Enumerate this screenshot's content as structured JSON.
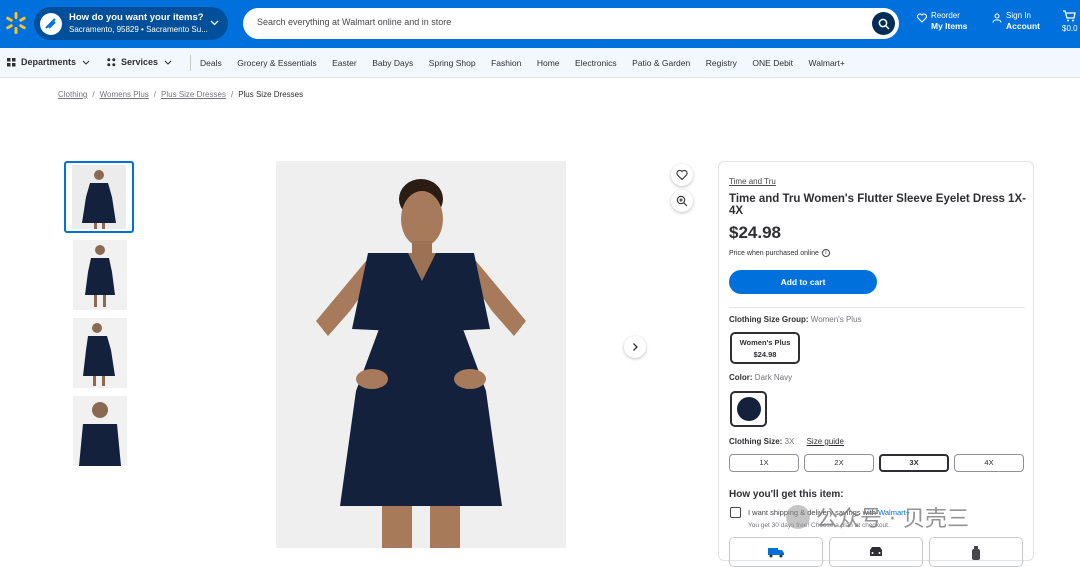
{
  "header": {
    "location_question": "How do you want your items?",
    "location_address": "Sacramento, 95829 • Sacramento Su...",
    "search_placeholder": "Search everything at Walmart online and in store",
    "reorder_small": "Reorder",
    "reorder_bold": "My Items",
    "signin_small": "Sign In",
    "signin_bold": "Account",
    "cart_total": "$0.0",
    "brand_color": "#0071dc"
  },
  "nav": {
    "departments": "Departments",
    "services": "Services",
    "links": [
      "Deals",
      "Grocery & Essentials",
      "Easter",
      "Baby Days",
      "Spring Shop",
      "Fashion",
      "Home",
      "Electronics",
      "Patio & Garden",
      "Registry",
      "ONE Debit",
      "Walmart+"
    ]
  },
  "breadcrumb": {
    "items": [
      "Clothing",
      "Womens Plus",
      "Plus Size Dresses"
    ],
    "current": "Plus Size Dresses"
  },
  "product": {
    "brand": "Time and Tru",
    "title": "Time and Tru Women's Flutter Sleeve Eyelet Dress 1X-4X",
    "price": "$24.98",
    "price_note": "Price when purchased online",
    "add_to_cart": "Add to cart",
    "size_group_label": "Clothing Size Group:",
    "size_group_value": "Women's Plus",
    "size_group_option_name": "Women's Plus",
    "size_group_option_price": "$24.98",
    "color_label": "Color:",
    "color_value": "Dark Navy",
    "color_hex": "#14213d",
    "size_label": "Clothing Size:",
    "size_value": "3X",
    "size_guide": "Size guide",
    "sizes": [
      "1X",
      "2X",
      "3X",
      "4X"
    ],
    "selected_size": "3X"
  },
  "fulfillment": {
    "heading": "How you'll get this item:",
    "shipping_text": "I want shipping & delivery savings with",
    "walmart_plus": "Walmart+",
    "sub_text": "You get 30 days free! Choose a plan at checkout.",
    "options_icons": [
      "shipping-icon",
      "pickup-icon",
      "delivery-icon"
    ]
  },
  "watermark": {
    "text": "公众号 · 贝壳三"
  }
}
